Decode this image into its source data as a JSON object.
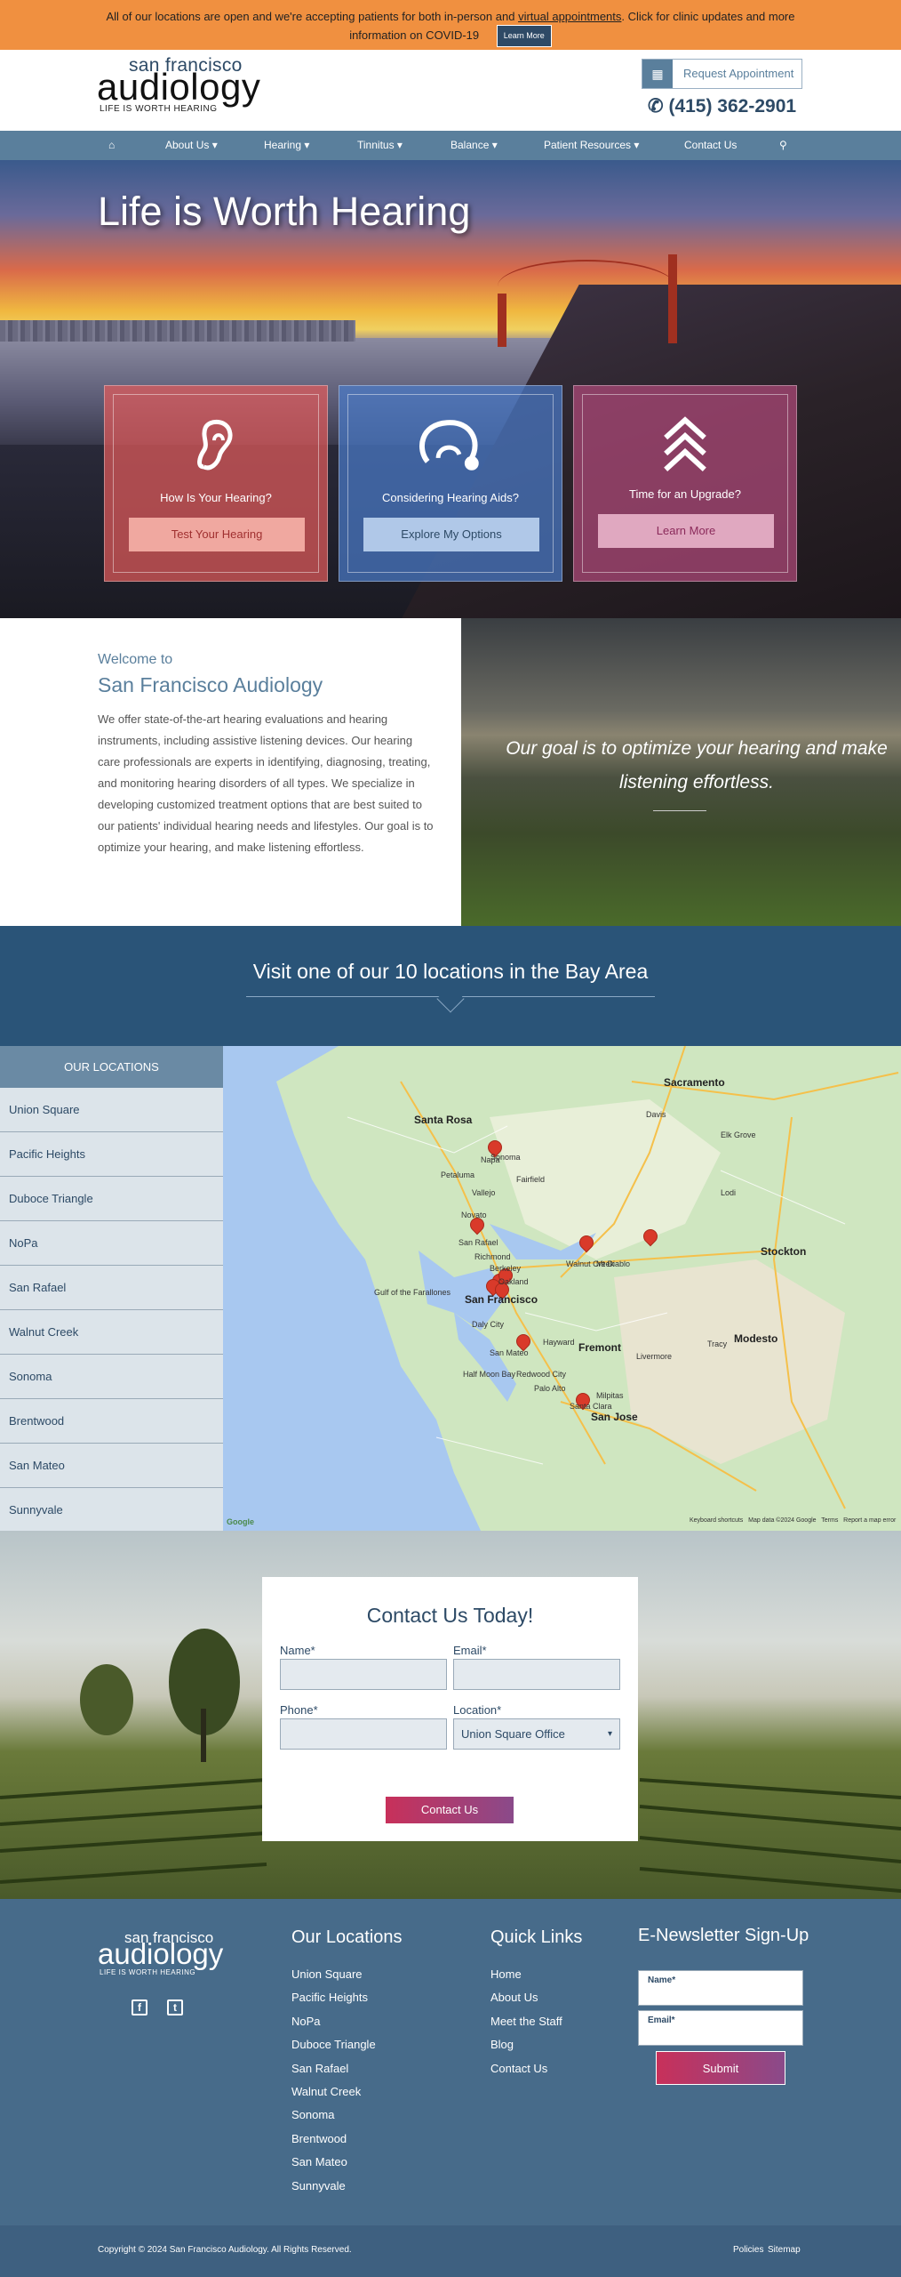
{
  "alert": {
    "text_before": "All of our locations are open and we're accepting patients for both in-person and",
    "link": "virtual appointments",
    "text_after": ". Click for clinic updates and more information on COVID-19",
    "button": "Learn More"
  },
  "header": {
    "logo_top": "san francisco",
    "logo_main": "audiology",
    "logo_tagline": "LIFE IS WORTH HEARING",
    "request_label": "Request Appointment",
    "phone": "(415) 362-2901"
  },
  "nav": {
    "items": [
      "About Us",
      "Hearing",
      "Tinnitus",
      "Balance",
      "Patient Resources",
      "Contact Us"
    ]
  },
  "hero": {
    "title": "Life is Worth Hearing",
    "cards": [
      {
        "label": "How Is Your Hearing?",
        "button": "Test Your Hearing",
        "icon": "ear-icon",
        "color": "#e05a5a"
      },
      {
        "label": "Considering Hearing Aids?",
        "button": "Explore My Options",
        "icon": "hearing-aid-icon",
        "color": "#4a7ac8"
      },
      {
        "label": "Time for an Upgrade?",
        "button": "Learn More",
        "icon": "chevrons-up-icon",
        "color": "#b04a7a"
      }
    ]
  },
  "welcome": {
    "subtitle": "Welcome to",
    "title": "San Francisco Audiology",
    "body": "We offer state-of-the-art hearing evaluations and hearing instruments, including assistive listening devices. Our hearing care professionals are experts in identifying, diagnosing, treating, and monitoring hearing disorders of all types. We specialize in developing customized treatment options that are best suited to our patients' individual hearing needs and lifestyles. Our goal is to optimize your hearing, and make listening effortless.",
    "quote": "Our goal is to optimize your hearing and make listening effortless."
  },
  "visit": {
    "title": "Visit one of our 10 locations in the Bay Area"
  },
  "locations": {
    "header": "OUR LOCATIONS",
    "items": [
      "Union Square",
      "Pacific Heights",
      "Duboce Triangle",
      "NoPa",
      "San Rafael",
      "Walnut Creek",
      "Sonoma",
      "Brentwood",
      "San Mateo",
      "Sunnyvale"
    ]
  },
  "map": {
    "labels": [
      "Sacramento",
      "Santa Rosa",
      "San Francisco",
      "Stockton",
      "Fremont",
      "San Jose",
      "Modesto",
      "Napa",
      "Vallejo",
      "Fairfield",
      "Petaluma",
      "Walnut Creek",
      "Mt Diablo",
      "Hayward",
      "Palo Alto",
      "Tracy",
      "Livermore",
      "Davis",
      "Elk Grove",
      "Lodi",
      "Novato",
      "San Rafael",
      "Richmond",
      "Oakland",
      "Berkeley",
      "Daly City",
      "San Mateo",
      "Redwood City",
      "Half Moon Bay",
      "Santa Clara",
      "Milpitas",
      "Sonoma",
      "Gulf of the Farallones"
    ],
    "footer": [
      "Keyboard shortcuts",
      "Map data ©2024 Google",
      "Terms",
      "Report a map error"
    ],
    "google": "Google"
  },
  "contact": {
    "title": "Contact Us Today!",
    "name_label": "Name*",
    "email_label": "Email*",
    "phone_label": "Phone*",
    "location_label": "Location*",
    "location_value": "Union Square Office",
    "button": "Contact Us"
  },
  "footer": {
    "logo_top": "san francisco",
    "logo_main": "audiology",
    "logo_tagline": "LIFE IS WORTH HEARING",
    "locations_title": "Our Locations",
    "locations": [
      "Union Square",
      "Pacific Heights",
      "NoPa",
      "Duboce Triangle",
      "San Rafael",
      "Walnut Creek",
      "Sonoma",
      "Brentwood",
      "San Mateo",
      "Sunnyvale"
    ],
    "quick_title": "Quick Links",
    "quick": [
      "Home",
      "About Us",
      "Meet the Staff",
      "Blog",
      "Contact Us"
    ],
    "news_title": "E-Newsletter Sign-Up",
    "news_name": "Name*",
    "news_email": "Email*",
    "news_button": "Submit",
    "copyright": "Copyright © 2024 San Francisco Audiology. All Rights Reserved.",
    "policies": "Policies",
    "sitemap": "Sitemap"
  },
  "colors": {
    "alert": "#f09040",
    "brand_blue": "#2d4a66",
    "nav": "#5a7f9c",
    "footer": "#476b8a"
  }
}
